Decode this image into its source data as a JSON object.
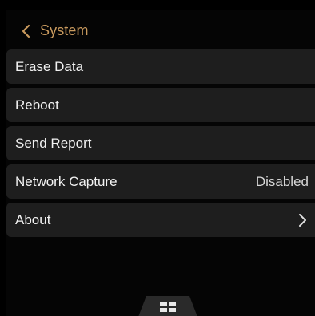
{
  "header": {
    "title": "System",
    "back_icon": "chevron-left-icon",
    "accent_color": "#c99a5e"
  },
  "menu": {
    "items": [
      {
        "label": "Erase Data"
      },
      {
        "label": "Reboot"
      },
      {
        "label": "Send Report"
      },
      {
        "label": "Network Capture",
        "value": "Disabled"
      },
      {
        "label": "About",
        "trailing_icon": "chevron-right-icon"
      }
    ]
  },
  "bottom_bar": {
    "icon": "grid-menu-icon"
  }
}
